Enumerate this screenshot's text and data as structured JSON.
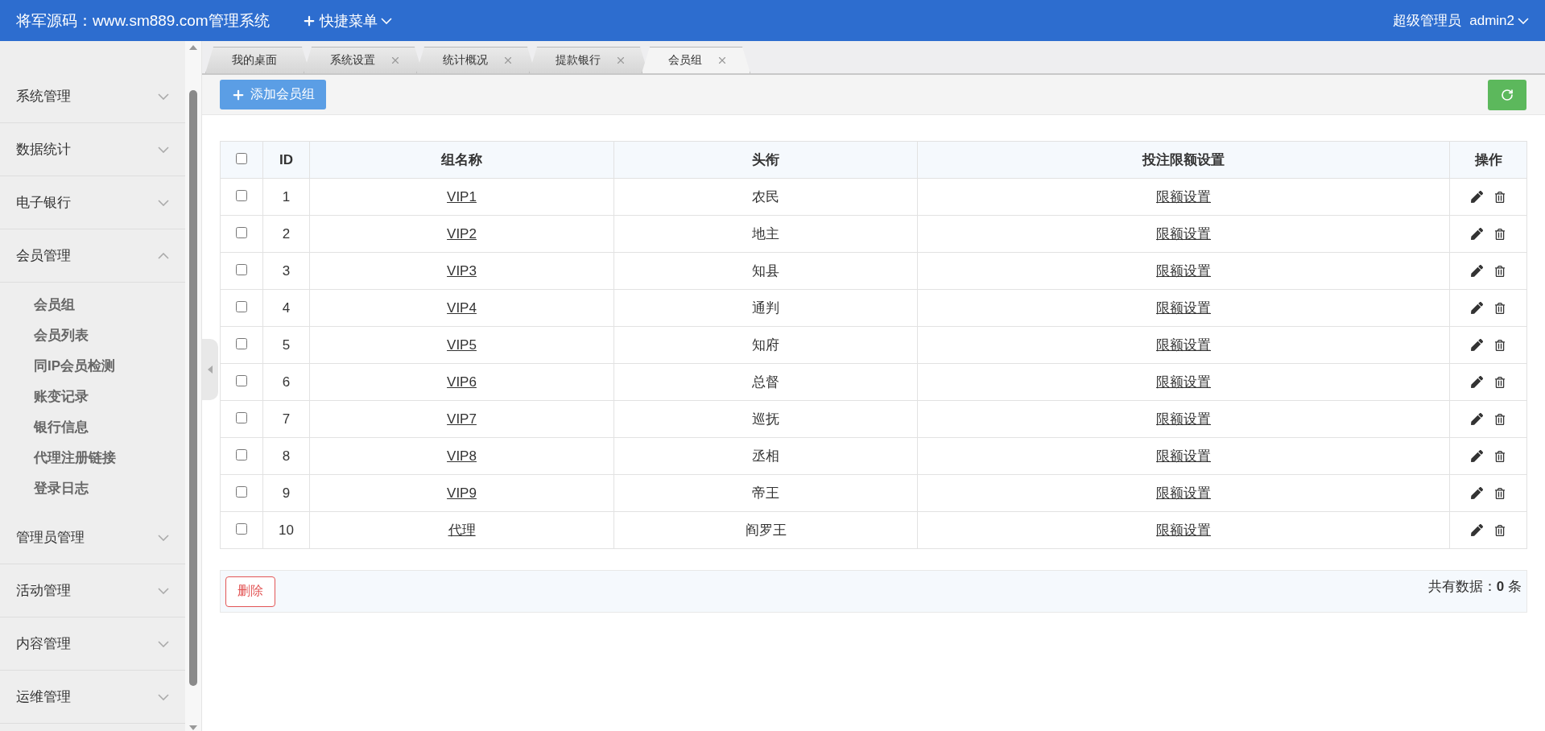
{
  "header": {
    "title": "将军源码：www.sm889.com管理系统",
    "quick_menu": "快捷菜单",
    "role": "超级管理员",
    "user": "admin2"
  },
  "sidebar": {
    "groups": [
      {
        "label": "系统管理",
        "expanded": false
      },
      {
        "label": "数据统计",
        "expanded": false
      },
      {
        "label": "电子银行",
        "expanded": false
      },
      {
        "label": "会员管理",
        "expanded": true,
        "children": [
          {
            "label": "会员组"
          },
          {
            "label": "会员列表"
          },
          {
            "label": "同IP会员检测"
          },
          {
            "label": "账变记录"
          },
          {
            "label": "银行信息"
          },
          {
            "label": "代理注册链接"
          },
          {
            "label": "登录日志"
          }
        ]
      },
      {
        "label": "管理员管理",
        "expanded": false
      },
      {
        "label": "活动管理",
        "expanded": false
      },
      {
        "label": "内容管理",
        "expanded": false
      },
      {
        "label": "运维管理",
        "expanded": false
      }
    ]
  },
  "tabs": [
    {
      "label": "我的桌面",
      "selected": false,
      "closable": false
    },
    {
      "label": "系统设置",
      "selected": false,
      "closable": true
    },
    {
      "label": "统计概况",
      "selected": false,
      "closable": true
    },
    {
      "label": "提款银行",
      "selected": false,
      "closable": true
    },
    {
      "label": "会员组",
      "selected": true,
      "closable": true
    }
  ],
  "toolbar": {
    "add_button": "添加会员组"
  },
  "table": {
    "header_checked": false,
    "columns": [
      "ID",
      "组名称",
      "头衔",
      "投注限额设置",
      "操作"
    ],
    "rows": [
      {
        "checked": false,
        "id": "1",
        "name": "VIP1",
        "title": "农民",
        "limit": "限额设置"
      },
      {
        "checked": false,
        "id": "2",
        "name": "VIP2",
        "title": "地主",
        "limit": "限额设置"
      },
      {
        "checked": false,
        "id": "3",
        "name": "VIP3",
        "title": "知县",
        "limit": "限额设置"
      },
      {
        "checked": false,
        "id": "4",
        "name": "VIP4",
        "title": "通判",
        "limit": "限额设置"
      },
      {
        "checked": false,
        "id": "5",
        "name": "VIP5",
        "title": "知府",
        "limit": "限额设置"
      },
      {
        "checked": false,
        "id": "6",
        "name": "VIP6",
        "title": "总督",
        "limit": "限额设置"
      },
      {
        "checked": false,
        "id": "7",
        "name": "VIP7",
        "title": "巡抚",
        "limit": "限额设置"
      },
      {
        "checked": false,
        "id": "8",
        "name": "VIP8",
        "title": "丞相",
        "limit": "限额设置"
      },
      {
        "checked": false,
        "id": "9",
        "name": "VIP9",
        "title": "帝王",
        "limit": "限额设置"
      },
      {
        "checked": false,
        "id": "10",
        "name": "代理",
        "title": "阎罗王",
        "limit": "限额设置"
      }
    ]
  },
  "footer": {
    "delete_button": "删除",
    "total_label": "共有数据：",
    "total_count": "0",
    "total_unit": "条"
  }
}
